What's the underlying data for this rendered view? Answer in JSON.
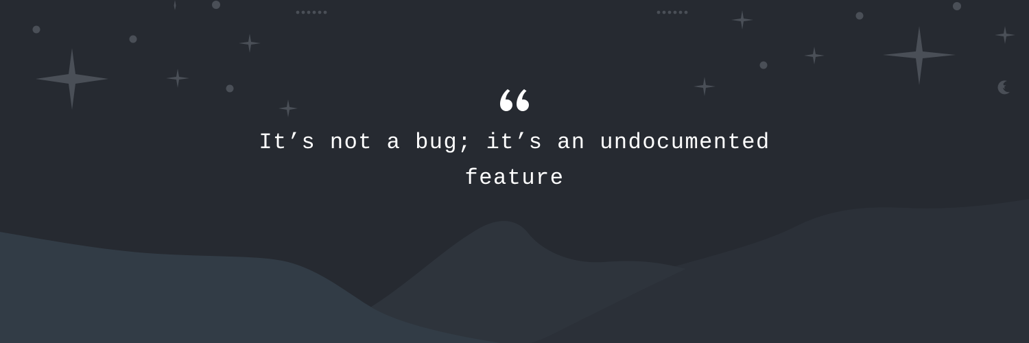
{
  "quote": {
    "text": "It’s not a bug; it’s an undocumented feature"
  },
  "icons": {
    "quote_mark": "opening-quote-icon",
    "stars": "sparkle-star-icon",
    "moon": "crescent-moon-icon"
  },
  "colors": {
    "sky": "#262a31",
    "text": "#ffffff",
    "star": "#4a4f57",
    "hill_front": "#323c46",
    "hill_mid": "#2e343c",
    "hill_back": "#2b3038"
  }
}
